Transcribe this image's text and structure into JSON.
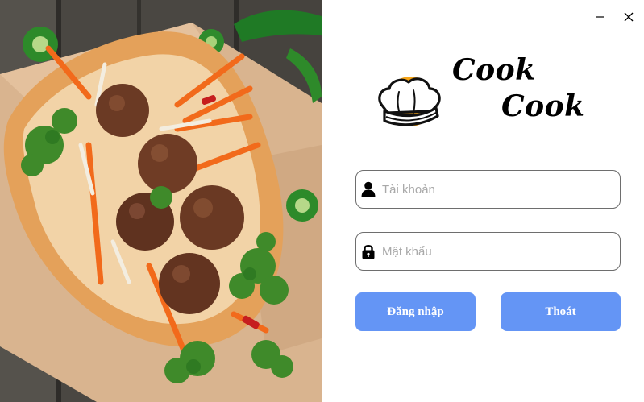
{
  "window": {
    "controls": {
      "minimize_icon": "minimize-icon",
      "close_icon": "close-icon"
    }
  },
  "brand": {
    "line1": "Cook",
    "line2": "Cook",
    "logo_icon": "chef-hat-icon",
    "accent_color": "#f5a418"
  },
  "login_form": {
    "username": {
      "value": "",
      "placeholder": "Tài khoản",
      "icon": "user-icon"
    },
    "password": {
      "value": "",
      "placeholder": "Mật khẩu",
      "icon": "lock-icon"
    },
    "login_label": "Đăng nhập",
    "exit_label": "Thoát"
  },
  "colors": {
    "button": "#6495f5",
    "field_border": "#6e6e6e"
  },
  "hero_image": {
    "subject": "banh-mi-meatball-sandwich"
  }
}
